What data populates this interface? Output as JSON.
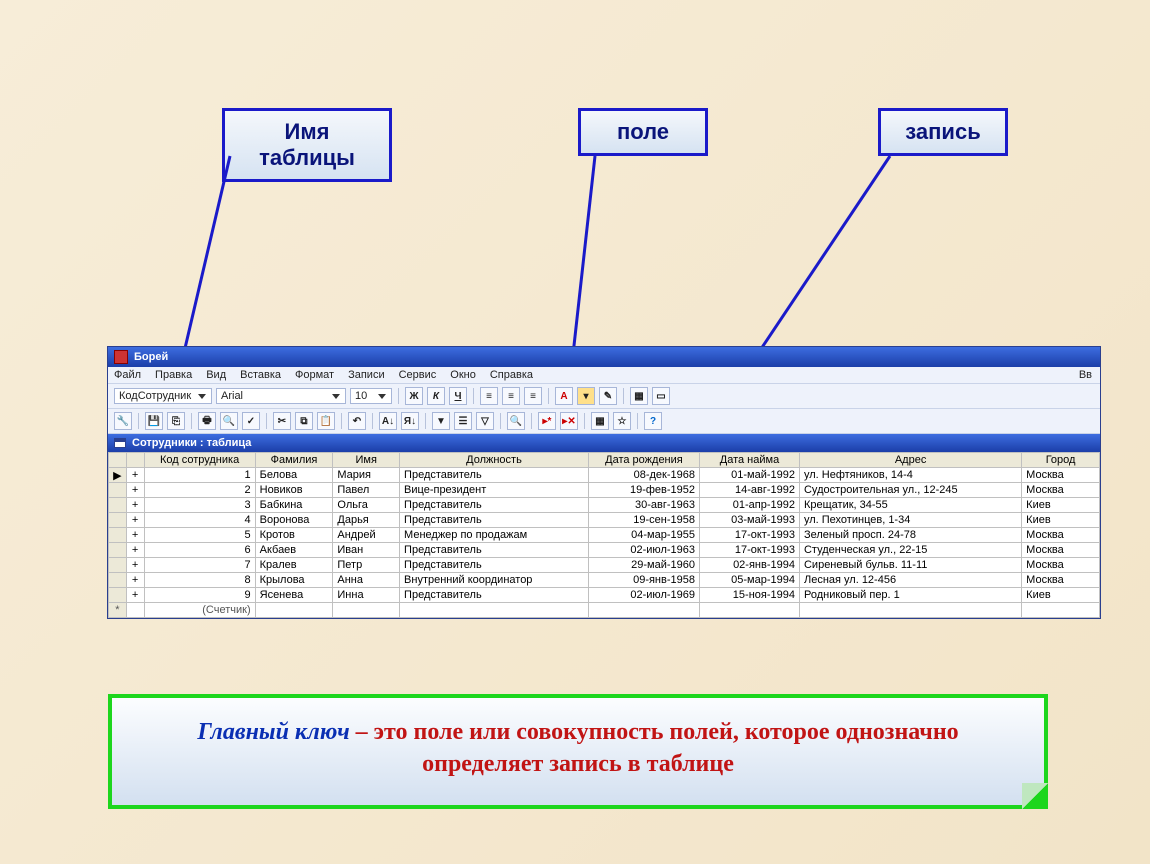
{
  "labels": {
    "table_name": "Имя таблицы",
    "field": "поле",
    "record": "запись"
  },
  "app": {
    "title": "Борей",
    "menus": [
      "Файл",
      "Правка",
      "Вид",
      "Вставка",
      "Формат",
      "Записи",
      "Сервис",
      "Окно",
      "Справка"
    ],
    "menu_right": "Вв",
    "toolbar1": {
      "field_selector": "КодСотрудник",
      "font": "Arial",
      "size": "10",
      "bold": "Ж",
      "italic": "К",
      "underline": "Ч"
    }
  },
  "subwindow": {
    "title": "Сотрудники : таблица"
  },
  "columns": [
    "Код сотрудника",
    "Фамилия",
    "Имя",
    "Должность",
    "Дата рождения",
    "Дата найма",
    "Адрес",
    "Город"
  ],
  "rows": [
    {
      "id": "1",
      "ln": "Белова",
      "fn": "Мария",
      "pos": "Представитель",
      "dob": "08-дек-1968",
      "hire": "01-май-1992",
      "addr": "ул. Нефтяников, 14-4",
      "city": "Москва"
    },
    {
      "id": "2",
      "ln": "Новиков",
      "fn": "Павел",
      "pos": "Вице-президент",
      "dob": "19-фев-1952",
      "hire": "14-авг-1992",
      "addr": "Судостроительная ул., 12-245",
      "city": "Москва"
    },
    {
      "id": "3",
      "ln": "Бабкина",
      "fn": "Ольга",
      "pos": "Представитель",
      "dob": "30-авг-1963",
      "hire": "01-апр-1992",
      "addr": "Крещатик, 34-55",
      "city": "Киев"
    },
    {
      "id": "4",
      "ln": "Воронова",
      "fn": "Дарья",
      "pos": "Представитель",
      "dob": "19-сен-1958",
      "hire": "03-май-1993",
      "addr": "ул. Пехотинцев, 1-34",
      "city": "Киев"
    },
    {
      "id": "5",
      "ln": "Кротов",
      "fn": "Андрей",
      "pos": "Менеджер по продажам",
      "dob": "04-мар-1955",
      "hire": "17-окт-1993",
      "addr": "Зеленый просп. 24-78",
      "city": "Москва"
    },
    {
      "id": "6",
      "ln": "Акбаев",
      "fn": "Иван",
      "pos": "Представитель",
      "dob": "02-июл-1963",
      "hire": "17-окт-1993",
      "addr": "Студенческая ул., 22-15",
      "city": "Москва"
    },
    {
      "id": "7",
      "ln": "Кралев",
      "fn": "Петр",
      "pos": "Представитель",
      "dob": "29-май-1960",
      "hire": "02-янв-1994",
      "addr": "Сиреневый бульв. 11-11",
      "city": "Москва"
    },
    {
      "id": "8",
      "ln": "Крылова",
      "fn": "Анна",
      "pos": "Внутренний координатор",
      "dob": "09-янв-1958",
      "hire": "05-мар-1994",
      "addr": "Лесная ул. 12-456",
      "city": "Москва"
    },
    {
      "id": "9",
      "ln": "Ясенева",
      "fn": "Инна",
      "pos": "Представитель",
      "dob": "02-июл-1969",
      "hire": "15-ноя-1994",
      "addr": "Родниковый пер. 1",
      "city": "Киев"
    }
  ],
  "new_row_placeholder": "(Счетчик)",
  "definition": {
    "key": "Главный ключ",
    "rest": " – это поле или совокупность полей, которое однозначно определяет запись в таблице"
  }
}
